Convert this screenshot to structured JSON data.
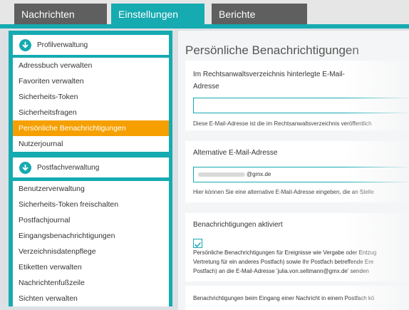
{
  "tabs": [
    "Nachrichten",
    "Einstellungen",
    "Berichte"
  ],
  "sidebar": {
    "profil": {
      "title": "Profilverwaltung",
      "items": [
        "Adressbuch verwalten",
        "Favoriten verwalten",
        "Sicherheits-Token",
        "Sicherheitsfragen",
        "Persönliche Benachrichtigungen",
        "Nutzerjournal"
      ]
    },
    "postfach": {
      "title": "Postfachverwaltung",
      "items": [
        "Benutzerverwaltung",
        "Sicherheits-Token freischalten",
        "Postfachjournal",
        "Eingangsbenachrichtigungen",
        "Verzeichnisdatenpflege",
        "Etiketten verwalten",
        "Nachrichtenfußzeile",
        "Sichten verwalten"
      ]
    }
  },
  "main": {
    "title": "Persönliche Benachrichtigungen",
    "card1": {
      "label_line1": "Im Rechtsanwaltsverzeichnis hinterlegte E-Mail-",
      "label_line2": "Adresse",
      "value": "",
      "hint": "Diese E-Mail-Adresse ist die im Rechtsanwaltsverzeichnis veröffentlich"
    },
    "card2": {
      "label": "Alternative E-Mail-Adresse",
      "value": "@gmx.de",
      "hint": "Hier können Sie eine alternative E-Mail-Adresse eingeben, die an Stelle"
    },
    "card3": {
      "label": "Benachrichtigungen aktiviert",
      "checked": true,
      "text_line1": "Persönliche Benachrichtigungen für Ereignisse wie Vergabe oder Entzug",
      "text_line2": "Vertretung für ein anderes Postfach) sowie Ihr Postfach betreffende Ere",
      "text_line3": "Postfach) an die E-Mail-Adresse 'julia.von.seltmann@gmx.de' senden"
    },
    "card4": {
      "text": "Benachrichtigungen beim Eingang einer Nachricht in einem Postfach kö"
    }
  },
  "colors": {
    "teal": "#16aab1",
    "active": "#f5a000",
    "tab_dark": "#5f5f5f"
  }
}
